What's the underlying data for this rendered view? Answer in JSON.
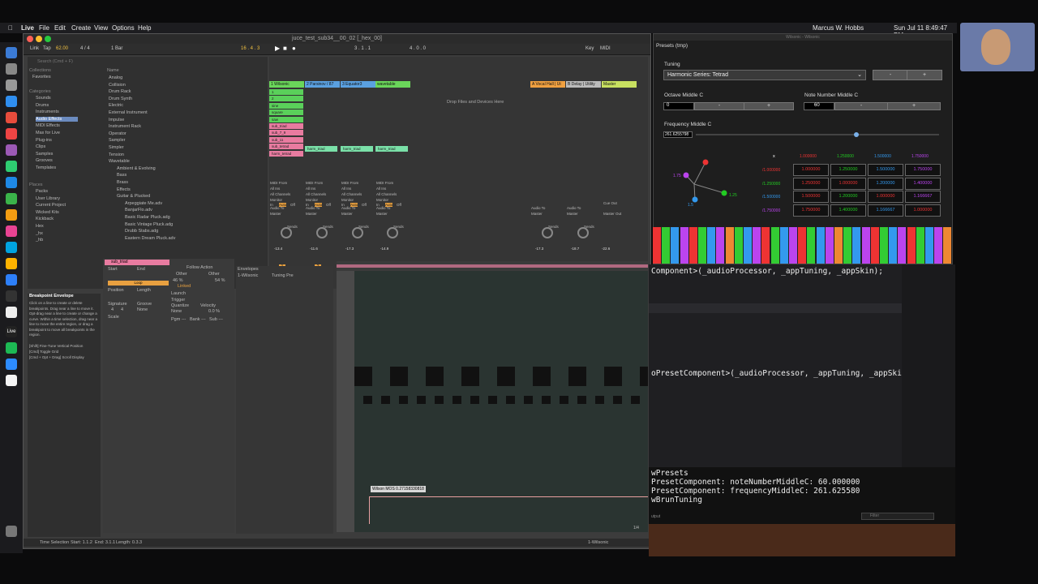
{
  "menubar": {
    "app": "Live",
    "items": [
      "File",
      "Edit",
      "Create",
      "View",
      "Options",
      "Help"
    ],
    "user": "Marcus W. Hobbs",
    "clock": "Sun Jul 11  8:49:47 PM"
  },
  "ableton": {
    "title": "juce_test_sub34__00_02  [_hex_00]",
    "control_bar": {
      "link": "Link",
      "tap": "Tap",
      "tempo": "62.00",
      "sig": "4 / 4",
      "bar": "1 Bar",
      "pos": "16 .  4 .  3",
      "loop_start": "3 .  1 .  1",
      "loop_len": "4 .  0 .  0",
      "key": "Key",
      "midi": "MIDI"
    },
    "browser": {
      "collections_title": "Collections",
      "collections": [
        "Favorites"
      ],
      "categories_title": "Categories",
      "categories": [
        "Sounds",
        "Drums",
        "Instruments",
        "Audio Effects",
        "MIDI Effects",
        "Max for Live",
        "Plug-ins",
        "Clips",
        "Samples",
        "Grooves",
        "Templates"
      ],
      "places_title": "Places",
      "places": [
        "Packs",
        "User Library",
        "Current Project",
        "Wicked Kits",
        "Kickback",
        "Hex",
        "_hx",
        "_hb"
      ],
      "name_header": "Name",
      "items": [
        "Analog",
        "Collision",
        "Drum Rack",
        "Drum Synth",
        "Electric",
        "External Instrument",
        "Impulse",
        "Instrument Rack",
        "Operator",
        "Sampler",
        "Simpler",
        "Tension",
        "Wavetable",
        "Ambient & Evolving",
        "Bass",
        "Brass",
        "Effects",
        "Guitar & Plucked",
        "Arpeggiate Me.adv",
        "BanjarFlo.adv",
        "Basic Radar Pluck.adg",
        "Basic Vintage Pluck.adg",
        "Drubb Stabs.adg",
        "Eastern Dream Pluck.adv"
      ],
      "search": "Search (Cmd + F)"
    },
    "tracks": [
      {
        "name": "1 Wilsonic",
        "color": "#6ad65a"
      },
      {
        "name": "2 Parsinov / 87",
        "color": "#5aa0e0"
      },
      {
        "name": "3 Equator3",
        "color": "#5aa0e0"
      },
      {
        "name": "wavetable",
        "color": "#6ad65a"
      },
      {
        "name": "A Vocal Hall | Ut",
        "color": "#f0a040"
      },
      {
        "name": "B Delay | Utility",
        "color": "#bbbbbb"
      },
      {
        "name": "Master",
        "color": "#c8e060"
      }
    ],
    "clips": [
      "1",
      "2",
      "sine",
      "square",
      "saw",
      "sub_triad",
      "sub_7_9",
      "sub_11",
      "sub_tetrad",
      "harm_tetrad"
    ],
    "clip_names": {
      "harm_triad": "harm_triad"
    },
    "drop": "Drop Files and Devices Here",
    "mixer": {
      "midi_from": "MIDI From",
      "all_ins": "All Ins",
      "all_channels": "All Channels",
      "monitor": "Monitor",
      "in": "In",
      "auto": "Auto",
      "off": "Off",
      "audio_to": "Audio To",
      "master": "Master",
      "sends": "Sends",
      "cue_out": "Cue Out",
      "master_out": "Master Out",
      "volumes": [
        "-13.4",
        "-11.6",
        "-17.3",
        "-14.9",
        "-17.3",
        "-18.7",
        "-22.6"
      ]
    },
    "info": {
      "title": "Breakpoint Envelope",
      "text": "Click on a line to create or delete breakpoints. Drag near a line to move it. Opt-drag near a line to create or change a curve. Within a time selection, drag near a line to move the entire region, or drag a breakpoint to move all breakpoints in the region.",
      "hint1": "[Shift] Fine-Tune Vertical Position",
      "hint2": "[Cmd] Toggle Grid",
      "hint3": "[Cmd + Opt + Drag] Scroll Display"
    },
    "clip_view": {
      "clip": "sub_triad",
      "start": "Start",
      "end": "End",
      "loop": "Loop",
      "position": "Position",
      "length": "Length",
      "signature": "Signature",
      "groove": "Groove",
      "sig_num": "4",
      "sig_den": "4",
      "groove_val": "None",
      "scale": "Scale",
      "follow": "Follow Action",
      "other": "Other",
      "pct1": "46 %",
      "pct2": "54 %",
      "linked": "Linked",
      "launch": "Launch",
      "trigger": "Trigger",
      "velocity": "Velocity",
      "quantize": "Quantize",
      "q_none": "None",
      "vel_val": "0.0 %",
      "pgm": "Pgm ---",
      "bank": "Bank ---",
      "sub": "Sub ---",
      "envelopes": "Envelopes",
      "env_dev": "1-Wilsonic",
      "env_param": "Tuning Pre"
    },
    "envelope_tip": "Wilson MOS 0.27158330818",
    "status": {
      "time_sel": "Time Selection",
      "start": "Start: 1.1.2",
      "end": "End: 3.1.1",
      "length": "Length: 0.3.3",
      "track": "1-Wilsonic",
      "zoom": "1/4"
    }
  },
  "plugin": {
    "window_title": "Wilsonic - Wilsonic",
    "presets": "Presets (tmp)",
    "tuning_label": "Tuning",
    "tuning_value": "Harmonic Series: Tetrad",
    "minus": "-",
    "plus": "+",
    "octave_label": "Octave Middle C",
    "octave_value": "0",
    "note_label": "Note Number Middle C",
    "note_value": "60",
    "freq_label": "Frequency Middle C",
    "freq_value": "261.6255798",
    "freq_fraction": 0.65,
    "graph_labels": [
      "1.75",
      "1.25",
      "1.5"
    ],
    "table": {
      "corner": "x",
      "cols": [
        "1.000000",
        "1.250000",
        "1.500000",
        "1.750000"
      ],
      "rows": [
        {
          "h": "/1.000000",
          "v": [
            "1.000000",
            "1.250000",
            "1.500000",
            "1.750000"
          ]
        },
        {
          "h": "/1.250000",
          "v": [
            "1.250000",
            "1.000000",
            "1.200000",
            "1.400000"
          ]
        },
        {
          "h": "/1.500000",
          "v": [
            "1.500000",
            "1.200000",
            "1.000000",
            "1.166667"
          ]
        },
        {
          "h": "/1.750000",
          "v": [
            "1.750000",
            "1.400000",
            "1.166667",
            "1.000000"
          ]
        }
      ]
    }
  },
  "code": {
    "line1": "Component>(_audioProcessor, _appTuning, _appSkin);",
    "line2": "oPresetComponent>(_audioProcessor, _appTuning, _appSkin);"
  },
  "console": {
    "l1": "wPresets",
    "l2": "PresetComponent: noteNumberMiddleC: 60.000000",
    "l3": "PresetComponent: frequencyMiddleC: 261.625580",
    "l4": "wBrunTuning",
    "output": "utput",
    "filter": "Filter"
  }
}
